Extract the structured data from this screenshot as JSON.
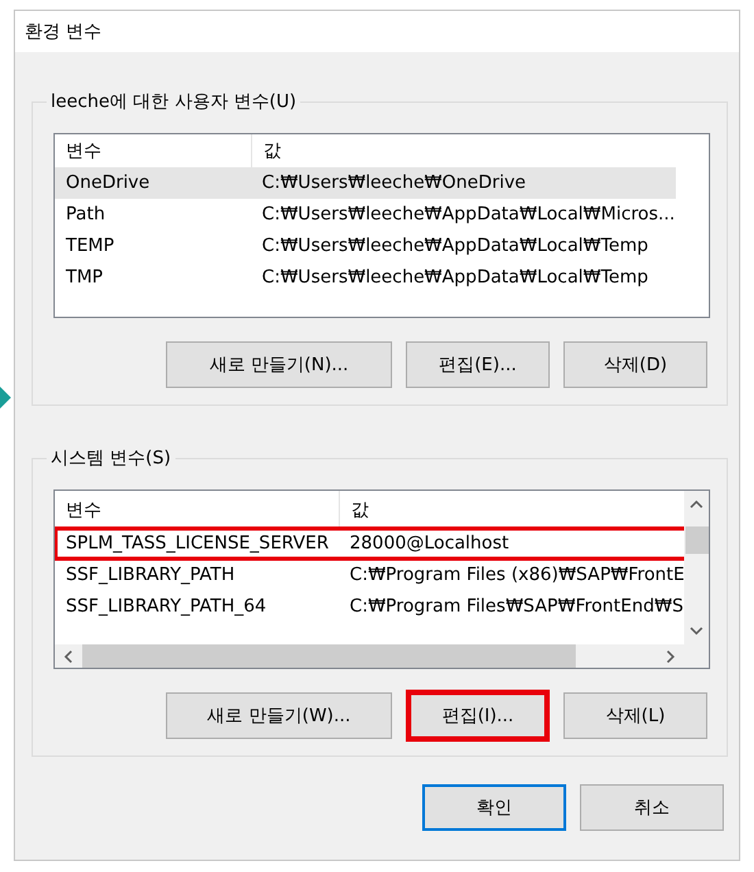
{
  "window": {
    "title": "환경 변수"
  },
  "user_group": {
    "legend": "leeche에 대한 사용자 변수(U)",
    "columns": [
      "변수",
      "값"
    ],
    "rows": [
      {
        "cells": [
          "OneDrive",
          "C:₩Users₩leeche₩OneDrive"
        ],
        "selected": true
      },
      {
        "cells": [
          "Path",
          "C:₩Users₩leeche₩AppData₩Local₩Micros..."
        ],
        "selected": false
      },
      {
        "cells": [
          "TEMP",
          "C:₩Users₩leeche₩AppData₩Local₩Temp"
        ],
        "selected": false
      },
      {
        "cells": [
          "TMP",
          "C:₩Users₩leeche₩AppData₩Local₩Temp"
        ],
        "selected": false
      }
    ],
    "buttons": [
      {
        "label": "새로 만들기(N)...",
        "highlighted": false
      },
      {
        "label": "편집(E)...",
        "highlighted": false
      },
      {
        "label": "삭제(D)",
        "highlighted": false
      }
    ]
  },
  "system_group": {
    "legend": "시스템 변수(S)",
    "columns": [
      "변수",
      "값"
    ],
    "rows": [
      {
        "cells": [
          "SPLM_TASS_LICENSE_SERVER",
          "28000@Localhost"
        ],
        "highlighted": true
      },
      {
        "cells": [
          "SSF_LIBRARY_PATH",
          "C:₩Program Files (x86)₩SAP₩FrontE"
        ],
        "highlighted": false
      },
      {
        "cells": [
          "SSF_LIBRARY_PATH_64",
          "C:₩Program Files₩SAP₩FrontEnd₩S"
        ],
        "highlighted": false
      }
    ],
    "buttons": [
      {
        "label": "새로 만들기(W)...",
        "highlighted": false
      },
      {
        "label": "편집(I)...",
        "highlighted": true
      },
      {
        "label": "삭제(L)",
        "highlighted": false
      }
    ]
  },
  "dialog_buttons": [
    {
      "label": "확인",
      "default": true
    },
    {
      "label": "취소",
      "default": false
    }
  ]
}
